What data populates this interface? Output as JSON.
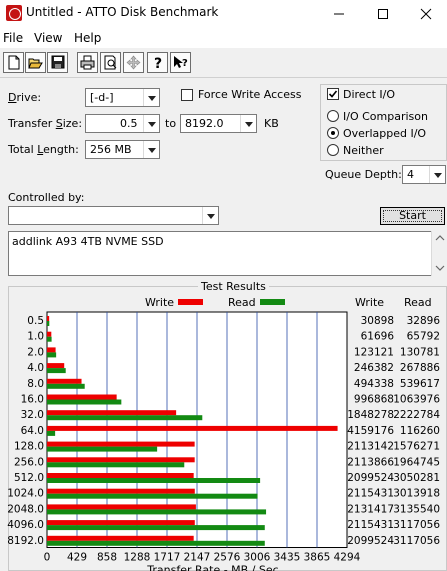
{
  "window": {
    "title": "Untitled - ATTO Disk Benchmark",
    "minimize_icon": "minimize-icon",
    "maximize_icon": "maximize-icon",
    "close_icon": "close-icon"
  },
  "menu": {
    "file": "File",
    "view": "View",
    "help": "Help"
  },
  "toolbar": {
    "icons": [
      "new-file-icon",
      "open-folder-icon",
      "save-icon",
      "print-icon",
      "print-preview-icon",
      "move-icon",
      "help-icon",
      "context-help-icon"
    ]
  },
  "settings": {
    "drive_label": "Drive:",
    "drive_value": "[-d-]",
    "force_write_label": "Force Write Access",
    "direct_io_label": "Direct I/O",
    "transfer_size_label": "Transfer Size:",
    "transfer_from": "0.5",
    "to_label": "to",
    "transfer_to": "8192.0",
    "kb_label": "KB",
    "total_length_label": "Total Length:",
    "total_length_value": "256 MB",
    "io_comparison_label": "I/O Comparison",
    "overlapped_io_label": "Overlapped I/O",
    "neither_label": "Neither",
    "queue_depth_label": "Queue Depth:",
    "queue_depth_value": "4",
    "controlled_by_label": "Controlled by:",
    "controlled_by_value": "",
    "start_label": "Start",
    "drive_description": "addlink A93 4TB NVME SSD"
  },
  "results": {
    "title": "Test Results",
    "write_legend": "Write",
    "read_legend": "Read",
    "write_header": "Write",
    "read_header": "Read",
    "write_color": "#ee0000",
    "read_color": "#138a13"
  },
  "chart_data": {
    "type": "bar",
    "orientation": "horizontal",
    "categories": [
      "0.5",
      "1.0",
      "2.0",
      "4.0",
      "8.0",
      "16.0",
      "32.0",
      "64.0",
      "128.0",
      "256.0",
      "512.0",
      "1024.0",
      "2048.0",
      "4096.0",
      "8192.0"
    ],
    "series": [
      {
        "name": "Write",
        "values": [
          30898,
          61696,
          123121,
          246382,
          494338,
          996868,
          1848278,
          4159176,
          2113142,
          2113866,
          2099524,
          2115431,
          2131417,
          2115431,
          2099524
        ]
      },
      {
        "name": "Read",
        "values": [
          32896,
          65792,
          130781,
          267886,
          539617,
          1063976,
          2222784,
          116260,
          1576271,
          1964745,
          3050281,
          3013918,
          3135540,
          3117056,
          3117056
        ]
      }
    ],
    "write_display": [
      "30898",
      "61696",
      "123121",
      "246382",
      "494338",
      "996868",
      "1848278",
      "4159176",
      "2113142",
      "2113866",
      "2099524",
      "2115431",
      "2131417",
      "2115431",
      "2099524"
    ],
    "read_display": [
      "32896",
      "65792",
      "130781",
      "267886",
      "539617",
      "1063976",
      "2222784",
      "116260",
      "1576271",
      "1964745",
      "3050281",
      "3013918",
      "3135540",
      "3117056",
      "3117056"
    ],
    "x_ticks": [
      "0",
      "429",
      "858",
      "1288",
      "1717",
      "2147",
      "2576",
      "3006",
      "3435",
      "3865",
      "4294"
    ],
    "xlim": [
      0,
      4294
    ],
    "xlabel": "Transfer Rate - MB / Sec",
    "grid": true
  }
}
